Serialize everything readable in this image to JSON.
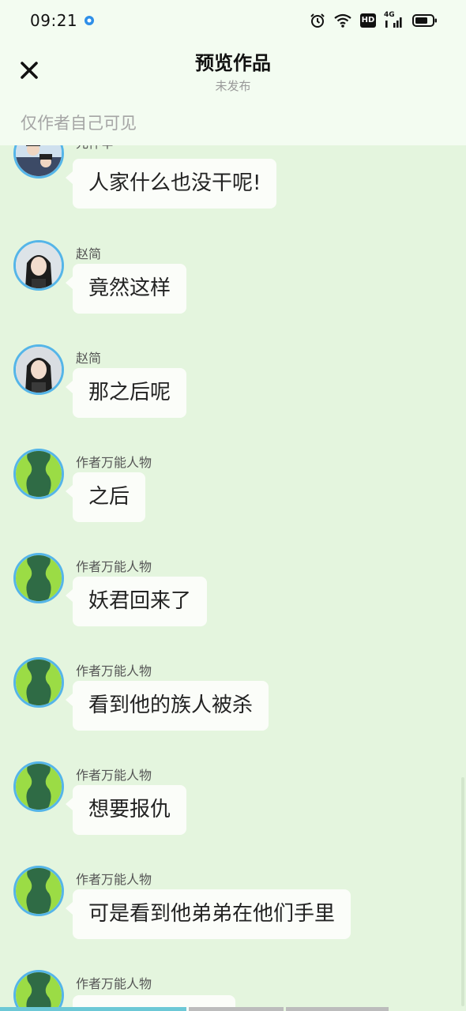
{
  "status_bar": {
    "time": "09:21",
    "hd_label": "HD",
    "network_label": "4G",
    "icons": [
      "notification-dot-icon",
      "alarm-icon",
      "wifi-icon",
      "hd-icon",
      "signal-icon",
      "battery-icon"
    ]
  },
  "header": {
    "close_icon": "close-icon",
    "title": "预览作品",
    "subtitle": "未发布",
    "visibility_note": "仅作者自己可见"
  },
  "messages": [
    {
      "sender": "元仲辛",
      "text": "人家什么也没干呢!",
      "avatar": "photo-avatar-icon"
    },
    {
      "sender": "赵简",
      "text": "竟然这样",
      "avatar": "photo-avatar-icon"
    },
    {
      "sender": "赵简",
      "text": "那之后呢",
      "avatar": "photo-avatar-icon"
    },
    {
      "sender": "作者万能人物",
      "text": "之后",
      "avatar": "green-silhouette-avatar-icon"
    },
    {
      "sender": "作者万能人物",
      "text": "妖君回来了",
      "avatar": "green-silhouette-avatar-icon"
    },
    {
      "sender": "作者万能人物",
      "text": "看到他的族人被杀",
      "avatar": "green-silhouette-avatar-icon"
    },
    {
      "sender": "作者万能人物",
      "text": "想要报仇",
      "avatar": "green-silhouette-avatar-icon"
    },
    {
      "sender": "作者万能人物",
      "text": "可是看到他弟弟在他们手里",
      "avatar": "green-silhouette-avatar-icon"
    },
    {
      "sender": "作者万能人物",
      "text": "",
      "avatar": "green-silhouette-avatar-icon"
    }
  ],
  "colors": {
    "background": "#e4f5de",
    "header_background": "#f3fcf1",
    "bubble": "#fbfdf9",
    "avatar_ring": "#55b5e8",
    "silhouette_dark": "#2f6b45",
    "silhouette_light": "#9bdc45"
  },
  "playback_progress": {
    "played_fraction": 0.4
  }
}
